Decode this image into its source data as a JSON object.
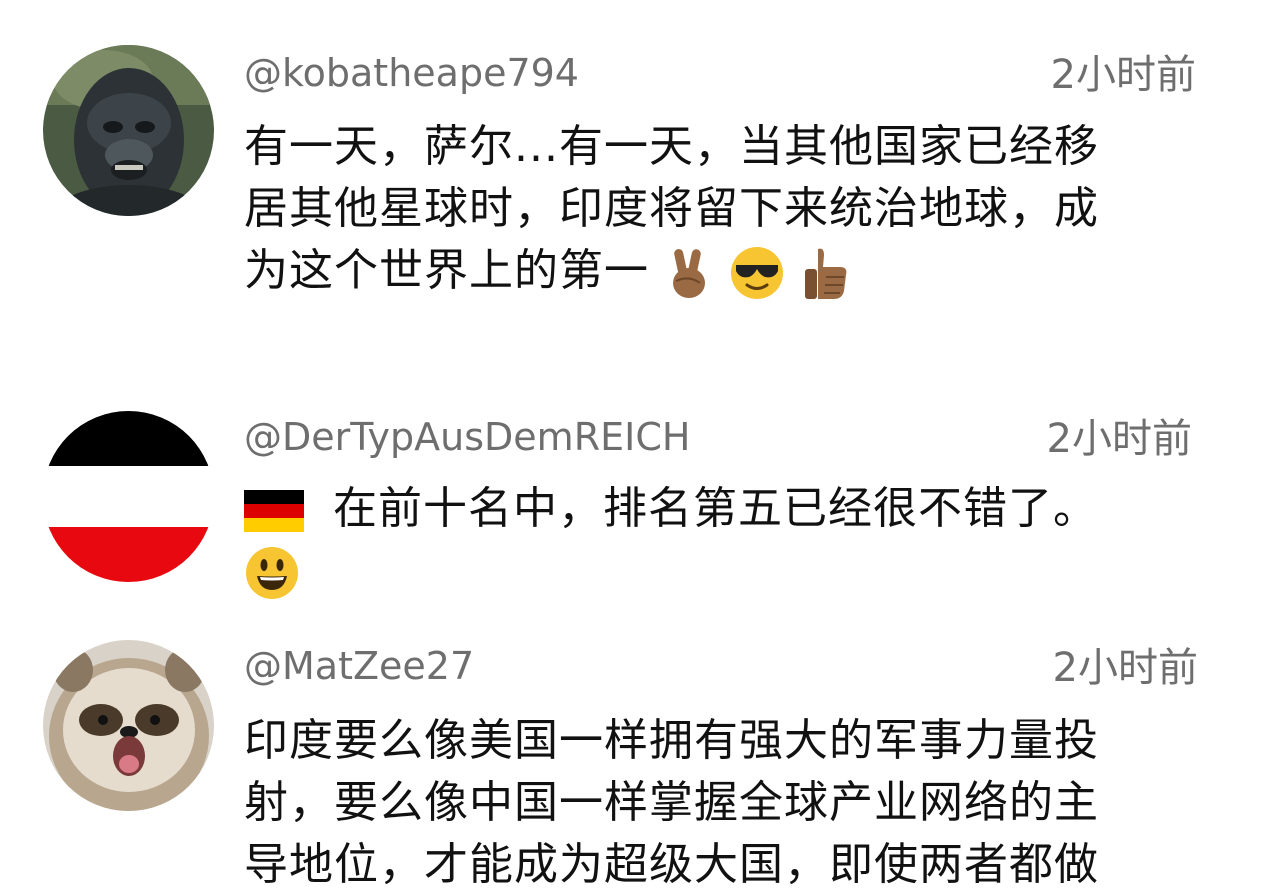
{
  "comments": [
    {
      "username": "@kobatheape794",
      "time": "2小时前",
      "text_lines": [
        "有一天，萨尔...有一天，当其他国家已经移",
        "居其他星球时，印度将留下来统治地球，成",
        "为这个世界上的第一"
      ],
      "avatar": "ape-avatar",
      "trailing_emojis": [
        "victory-hand-emoji",
        "sunglasses-face-emoji",
        "thumbs-up-emoji"
      ]
    },
    {
      "username": "@DerTypAusDemREICH",
      "time": "2小时前",
      "text_lines": [
        "在前十名中，排名第五已经很不错了。"
      ],
      "avatar": "imperial-flag-avatar",
      "leading_emojis": [
        "germany-flag-emoji"
      ],
      "trailing_emojis": [
        "grinning-face-emoji"
      ]
    },
    {
      "username": "@MatZee27",
      "time": "2小时前",
      "text_lines": [
        "印度要么像美国一样拥有强大的军事力量投",
        "射，要么像中国一样掌握全球产业网络的主",
        "导地位，才能成为超级大国，即使两者都做"
      ],
      "avatar": "raccoon-dog-avatar"
    }
  ],
  "colors": {
    "username": "#6e6e6e",
    "time": "#6e6e6e",
    "text": "#111111",
    "flag_black": "#000000",
    "flag_white": "#ffffff",
    "flag_red": "#e8080f",
    "emoji_yellow": "#f7c531"
  }
}
